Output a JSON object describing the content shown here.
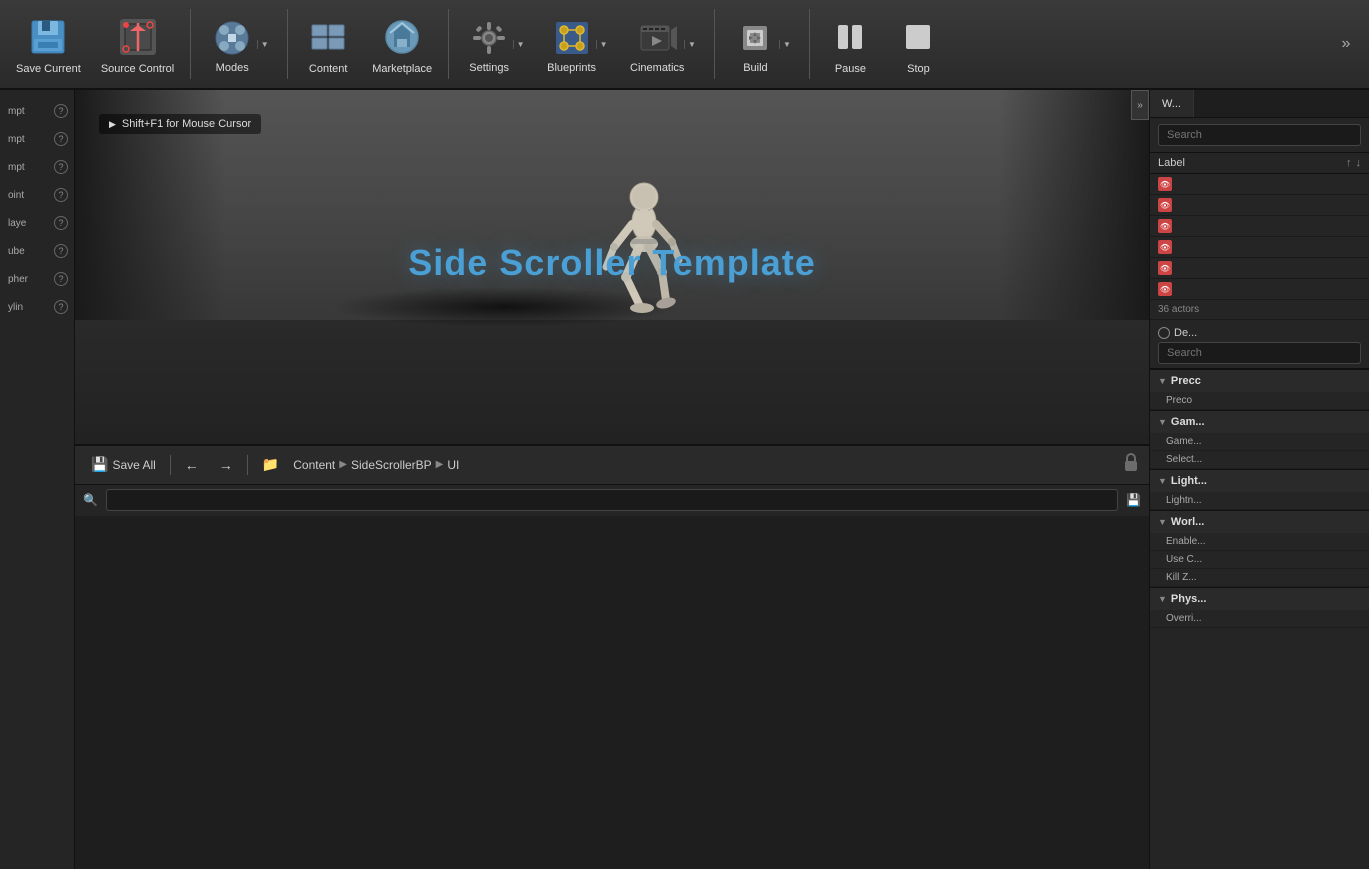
{
  "toolbar": {
    "save_current_label": "Save Current",
    "source_control_label": "Source Control",
    "modes_label": "Modes",
    "content_label": "Content",
    "marketplace_label": "Marketplace",
    "settings_label": "Settings",
    "blueprints_label": "Blueprints",
    "cinematics_label": "Cinematics",
    "build_label": "Build",
    "pause_label": "Pause",
    "stop_label": "Stop"
  },
  "left_panel": {
    "items": [
      {
        "label": "mpt",
        "suffix": "?"
      },
      {
        "label": "mpt",
        "suffix": "?"
      },
      {
        "label": "mpt",
        "suffix": "?"
      },
      {
        "label": "oint",
        "suffix": "?"
      },
      {
        "label": "laye",
        "suffix": "?"
      },
      {
        "label": "ube",
        "suffix": "?"
      },
      {
        "label": "pher",
        "suffix": "?"
      },
      {
        "label": "ylin",
        "suffix": "?"
      }
    ]
  },
  "viewport": {
    "hint": "Shift+F1 for Mouse Cursor",
    "title": "Side Scroller Template"
  },
  "content_browser": {
    "save_all_label": "Save All",
    "breadcrumb": [
      "Content",
      "SideScrollerBP",
      "UI"
    ],
    "search_placeholder": ""
  },
  "right_panel": {
    "tab_label": "W...",
    "search_placeholder": "Search",
    "label_col": "Label",
    "actors_count": "36 actors",
    "details_label": "De...",
    "details_search_placeholder": "Search",
    "sections": [
      {
        "name": "Precc",
        "label": "Precc",
        "items": [
          {
            "name": "Preco",
            "value": ""
          }
        ]
      },
      {
        "name": "Gam",
        "label": "Gam...",
        "items": [
          {
            "name": "Game...",
            "value": ""
          },
          {
            "name": "Select...",
            "value": ""
          }
        ]
      },
      {
        "name": "Light",
        "label": "Light...",
        "items": [
          {
            "name": "Lightn...",
            "value": ""
          }
        ]
      },
      {
        "name": "Worl",
        "label": "Worl...",
        "items": [
          {
            "name": "Enable...",
            "value": ""
          },
          {
            "name": "Use C...",
            "value": ""
          },
          {
            "name": "Kill Z...",
            "value": ""
          }
        ]
      },
      {
        "name": "Phys",
        "label": "Phys...",
        "items": [
          {
            "name": "Overri...",
            "value": ""
          }
        ]
      }
    ],
    "eye_rows": [
      {
        "label": "",
        "count": ""
      },
      {
        "label": "",
        "count": ""
      },
      {
        "label": "",
        "count": ""
      },
      {
        "label": "",
        "count": ""
      },
      {
        "label": "",
        "count": ""
      },
      {
        "label": "",
        "count": ""
      }
    ]
  }
}
